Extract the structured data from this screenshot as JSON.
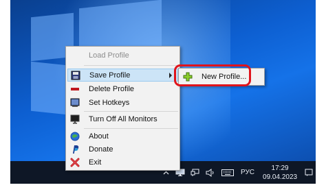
{
  "menu": {
    "items": [
      {
        "label": "Load Profile",
        "icon": "load-profile-icon",
        "disabled": true
      },
      {
        "label": "Save Profile",
        "icon": "save-icon",
        "submenu": true
      },
      {
        "label": "Delete Profile",
        "icon": "delete-icon"
      },
      {
        "label": "Set Hotkeys",
        "icon": "hotkeys-icon"
      },
      {
        "label": "Turn Off All Monitors",
        "icon": "monitor-off-icon"
      },
      {
        "label": "About",
        "icon": "about-icon"
      },
      {
        "label": "Donate",
        "icon": "paypal-icon"
      },
      {
        "label": "Exit",
        "icon": "exit-icon"
      }
    ]
  },
  "submenu": {
    "new_profile": "New Profile..."
  },
  "taskbar": {
    "language": "РУС",
    "time": "17:29",
    "date": "09.04.2023"
  },
  "colors": {
    "highlight_border": "#e0131b",
    "active_item": "#cce4f7",
    "taskbar": "#0e1726"
  }
}
